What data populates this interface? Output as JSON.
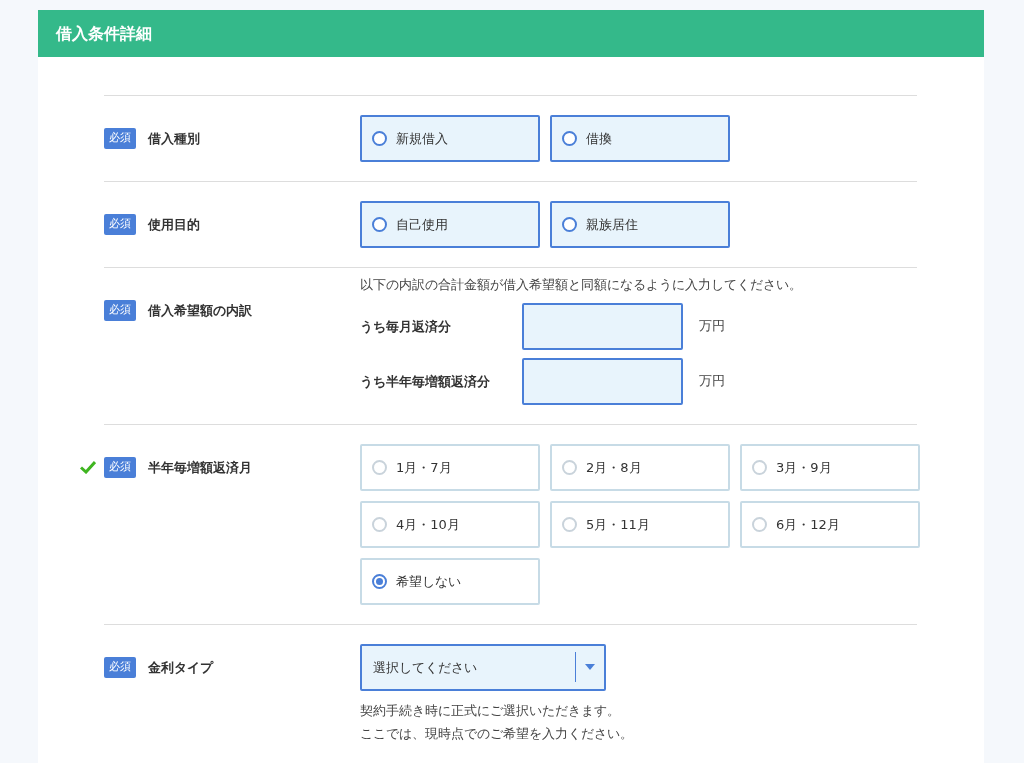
{
  "header": {
    "title": "借入条件詳細"
  },
  "sections": [
    {
      "kind": "radio",
      "badge": "必須",
      "label": "借入種別",
      "completed": false,
      "options": [
        {
          "label": "新規借入",
          "selected": false
        },
        {
          "label": "借換",
          "selected": false
        }
      ]
    },
    {
      "kind": "radio",
      "badge": "必須",
      "label": "使用目的",
      "completed": false,
      "options": [
        {
          "label": "自己使用",
          "selected": false
        },
        {
          "label": "親族居住",
          "selected": false
        }
      ]
    },
    {
      "kind": "amounts",
      "badge": "必須",
      "label": "借入希望額の内訳",
      "completed": false,
      "note": "以下の内訳の合計金額が借入希望額と同額になるように入力してください。",
      "fields": [
        {
          "label": "うち毎月返済分",
          "unit": "万円"
        },
        {
          "label": "うち半年毎増額返済分",
          "unit": "万円"
        }
      ]
    },
    {
      "kind": "radio",
      "badge": "必須",
      "label": "半年毎増額返済月",
      "completed": true,
      "options": [
        {
          "label": "1月・7月",
          "selected": false
        },
        {
          "label": "2月・8月",
          "selected": false
        },
        {
          "label": "3月・9月",
          "selected": false
        },
        {
          "label": "4月・10月",
          "selected": false
        },
        {
          "label": "5月・11月",
          "selected": false
        },
        {
          "label": "6月・12月",
          "selected": false
        },
        {
          "label": "希望しない",
          "selected": true
        }
      ]
    },
    {
      "kind": "select",
      "badge": "必須",
      "label": "金利タイプ",
      "completed": false,
      "placeholder": "選択してください",
      "notes": [
        "契約手続き時に正式にご選択いただきます。",
        "ここでは、現時点でのご希望を入力ください。"
      ]
    }
  ]
}
